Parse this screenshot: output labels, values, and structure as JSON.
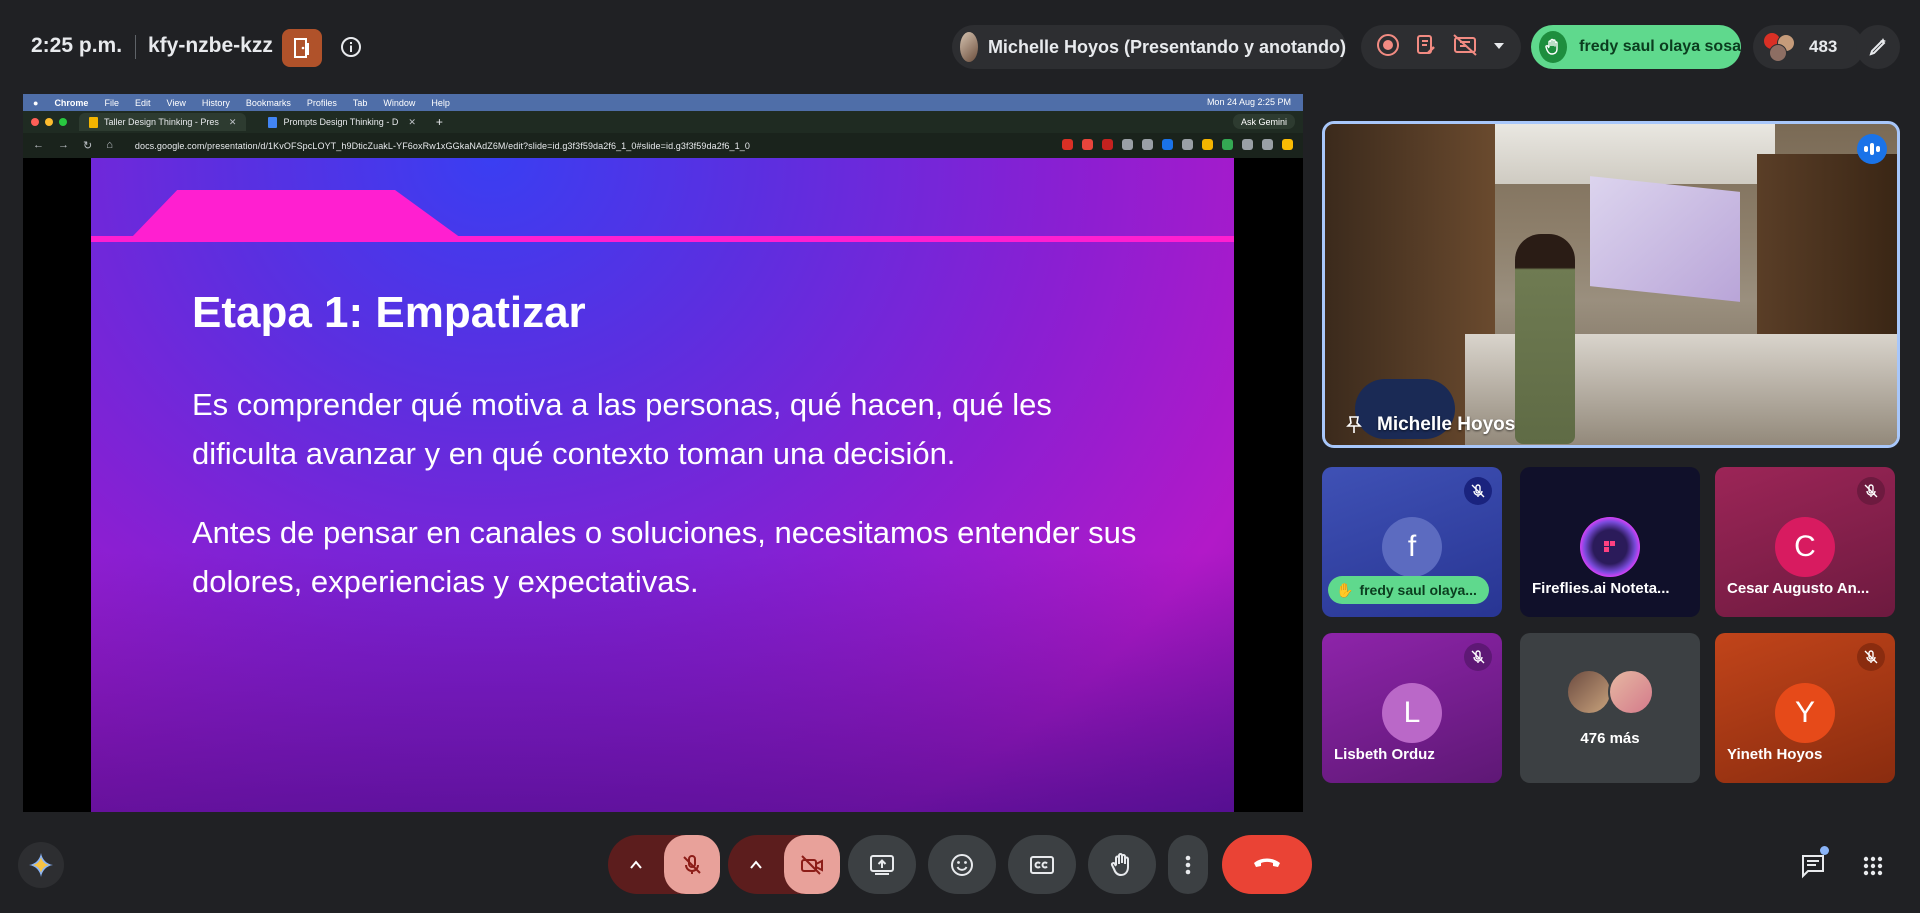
{
  "meeting": {
    "time": "2:25 p.m.",
    "code": "kfy-nzbe-kzz"
  },
  "presenter_chip": {
    "label": "Michelle Hoyos (Presentando y anotando)"
  },
  "raised_hand_chip": {
    "label": "fredy saul olaya sosa"
  },
  "participants_count": "483",
  "shared_screen": {
    "mac_menu": {
      "items": [
        "Chrome",
        "File",
        "Edit",
        "View",
        "History",
        "Bookmarks",
        "Profiles",
        "Tab",
        "Window",
        "Help"
      ],
      "datetime": "Mon 24 Aug 2:25 PM"
    },
    "tabs": [
      {
        "title": "Taller Design Thinking - Pres"
      },
      {
        "title": "Prompts Design Thinking - D"
      }
    ],
    "ask_gemini": "Ask Gemini",
    "url": "docs.google.com/presentation/d/1KvOFSpcLOYT_h9DticZuakL-YF6oxRw1xGGkaNAdZ6M/edit?slide=id.g3f3f59da2f6_1_0#slide=id.g3f3f59da2f6_1_0",
    "slide": {
      "title": "Etapa 1: Empatizar",
      "paragraph1": "Es comprender qué motiva a las personas, qué hacen, qué les dificulta avanzar y en qué contexto toman una decisión.",
      "paragraph2": "Antes de pensar en canales o soluciones, necesitamos entender sus dolores, experiencias y expectativas."
    }
  },
  "speaker_tile": {
    "name": "Michelle Hoyos"
  },
  "tiles": [
    {
      "initial": "f",
      "name": "fredy saul olaya...",
      "color": "#5c6bc0",
      "bg": "#3949ab"
    },
    {
      "initial": "",
      "name": "Fireflies.ai Noteta...",
      "color": "#1a1a40",
      "bg": "#0f0f2a"
    },
    {
      "initial": "C",
      "name": "Cesar Augusto An...",
      "color": "#c2185b",
      "bg": "#8e1f4e"
    },
    {
      "initial": "L",
      "name": "Lisbeth Orduz",
      "color": "#ab47bc",
      "bg": "#7b2c8f"
    },
    {
      "initial": "",
      "name": "476 más",
      "color": "#3c4043",
      "bg": "#3c4043"
    },
    {
      "initial": "Y",
      "name": "Yineth Hoyos",
      "color": "#e64a19",
      "bg": "#b53a14"
    }
  ],
  "icons": {
    "room": "door-icon",
    "info": "info-icon",
    "record": "record-icon",
    "notes": "notes-icon",
    "layout": "layout-icon",
    "hand": "hand-icon",
    "mic_off": "mic-off-icon",
    "cam_off": "camera-off-icon",
    "present": "present-screen-icon",
    "emoji": "emoji-icon",
    "captions": "captions-icon",
    "more": "more-vert-icon",
    "end_call": "end-call-icon",
    "chat": "chat-icon",
    "apps": "apps-icon",
    "gemini": "gemini-icon"
  },
  "colors": {
    "background": "#202124",
    "accent_green": "#5fd98d",
    "end_call": "#ea4335",
    "slide_pink": "#ff1fd0"
  }
}
